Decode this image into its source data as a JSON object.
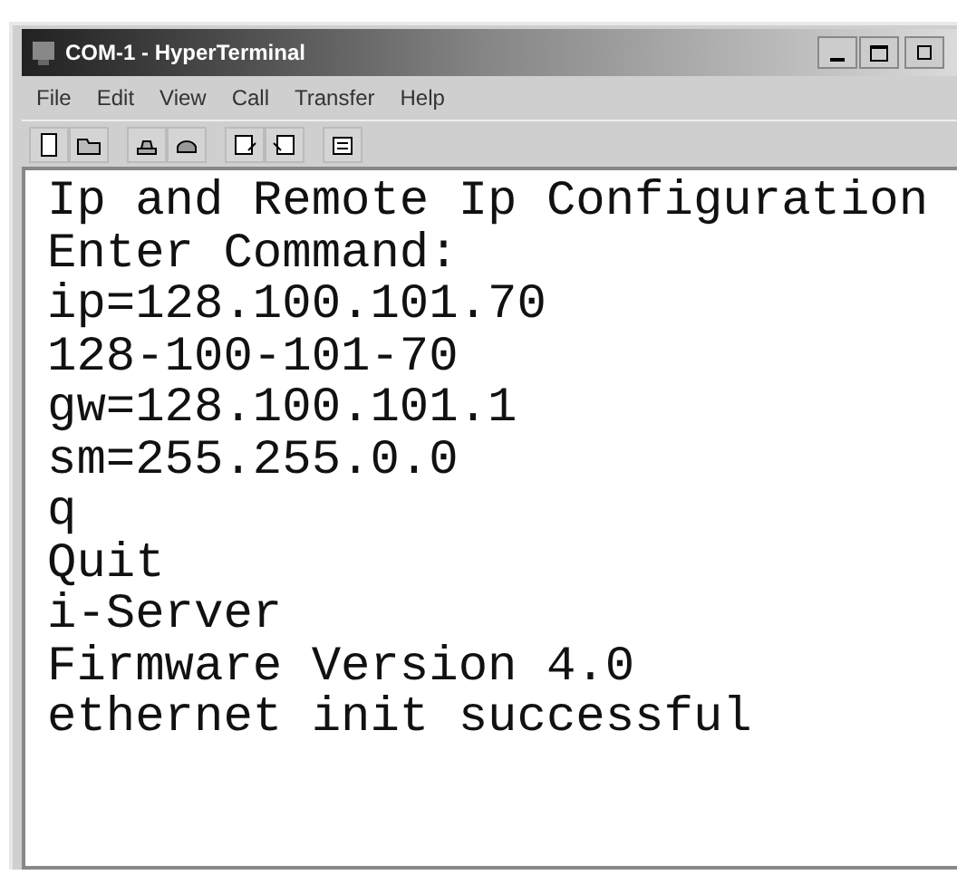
{
  "window": {
    "title": "COM-1 - HyperTerminal"
  },
  "menu": [
    "File",
    "Edit",
    "View",
    "Call",
    "Transfer",
    "Help"
  ],
  "terminal": {
    "lines": [
      "Ip and Remote Ip Configuration",
      "Enter Command:",
      "ip=128.100.101.70",
      "128-100-101-70",
      "gw=128.100.101.1",
      "sm=255.255.0.0",
      "q",
      "Quit",
      "i-Server",
      "Firmware Version 4.0",
      "ethernet init successful"
    ]
  }
}
